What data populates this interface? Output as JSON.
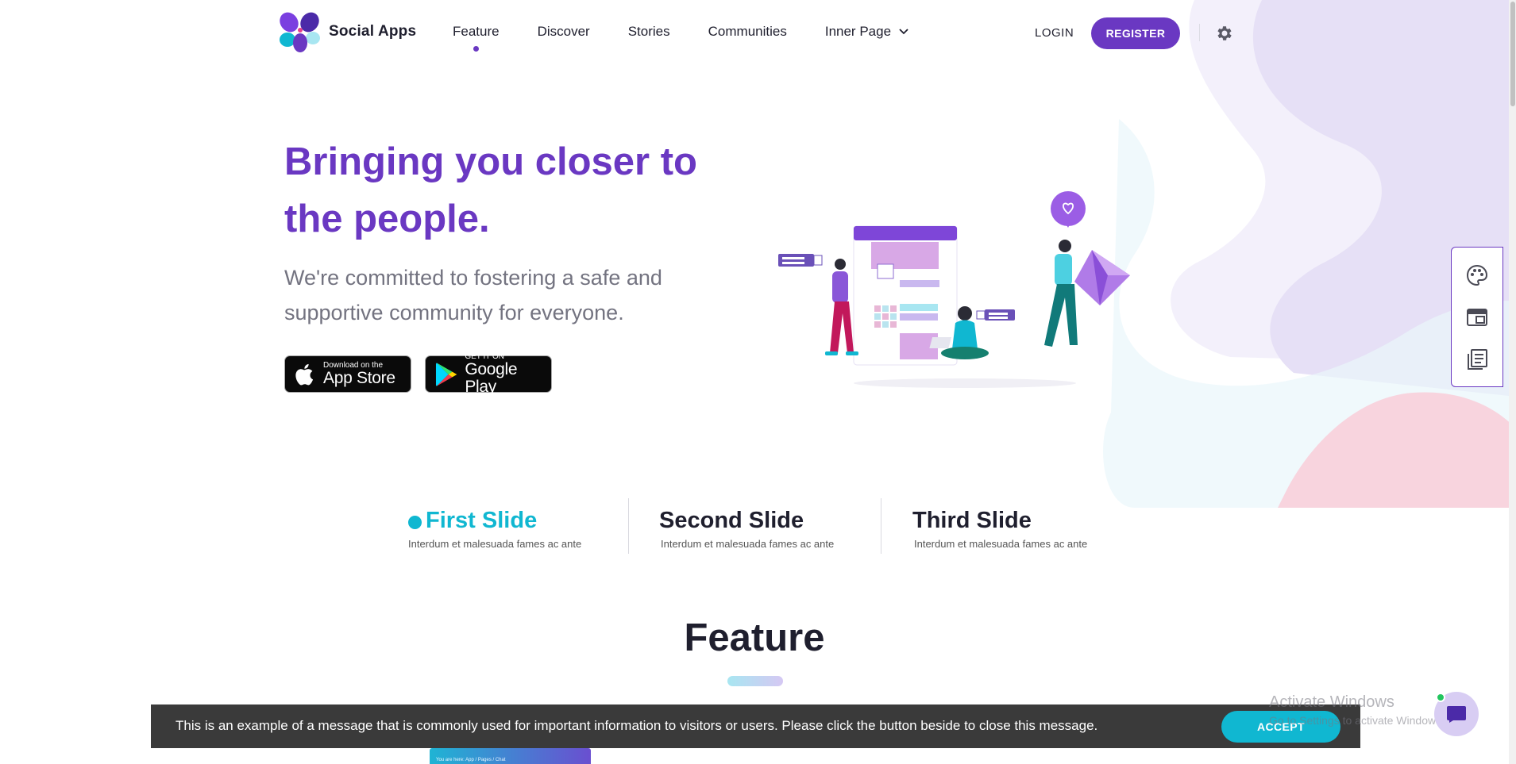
{
  "brand": {
    "name": "Social Apps",
    "accent": "#6a38c2",
    "secondary": "#10b7d1"
  },
  "nav": {
    "items": [
      {
        "label": "Feature",
        "active": true
      },
      {
        "label": "Discover"
      },
      {
        "label": "Stories"
      },
      {
        "label": "Communities"
      },
      {
        "label": "Inner Page",
        "has_dropdown": true
      }
    ],
    "login": "LOGIN",
    "register": "REGISTER",
    "settings_icon": "gear-icon"
  },
  "hero": {
    "title": "Bringing you closer to the people.",
    "subtitle": "We're committed to fostering a safe and supportive community for everyone.",
    "app_store": {
      "small": "Download on the",
      "big": "App Store"
    },
    "google_play": {
      "small": "GET IT ON",
      "big": "Google Play"
    }
  },
  "side_tools": [
    "palette-icon",
    "layout-icon",
    "pages-icon"
  ],
  "slides": [
    {
      "title": "First Slide",
      "desc": "Interdum et malesuada fames ac ante",
      "active": true
    },
    {
      "title": "Second Slide",
      "desc": "Interdum et malesuada fames ac ante"
    },
    {
      "title": "Third Slide",
      "desc": "Interdum et malesuada fames ac ante"
    }
  ],
  "feature": {
    "heading": "Feature"
  },
  "preview": {
    "breadcrumb": "You are here:  App  /  Pages  /  Chat"
  },
  "cookie": {
    "message": "This is an example of a message that is commonly used for important information to visitors or users. Please click the button beside to close this message.",
    "accept": "ACCEPT"
  },
  "watermark": {
    "line1": "Activate Windows",
    "line2": "Go to Settings to activate Windows."
  }
}
